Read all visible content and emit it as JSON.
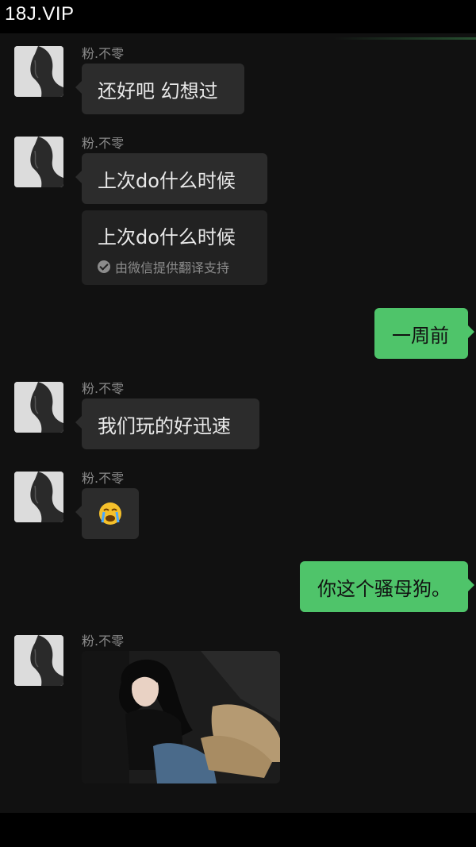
{
  "watermark": "18J.VIP",
  "contact": {
    "name": "粉.不零"
  },
  "messages": [
    {
      "side": "in",
      "text": "还好吧 幻想过"
    },
    {
      "side": "in",
      "text": "上次do什么时候"
    },
    {
      "side": "translation",
      "text": "上次do什么时候",
      "note": "由微信提供翻译支持"
    },
    {
      "side": "out",
      "text": "一周前"
    },
    {
      "side": "in",
      "text": "我们玩的好迅速"
    },
    {
      "side": "in",
      "emoji": "😭"
    },
    {
      "side": "out",
      "text": "你这个骚母狗。"
    },
    {
      "side": "in",
      "type": "image"
    }
  ],
  "colors": {
    "background": "#111111",
    "incoming_bubble": "#2c2c2c",
    "outgoing_bubble": "#4fc46a"
  },
  "icons": {
    "translation": "check-circle-icon",
    "emoji": "crying-face-icon"
  }
}
